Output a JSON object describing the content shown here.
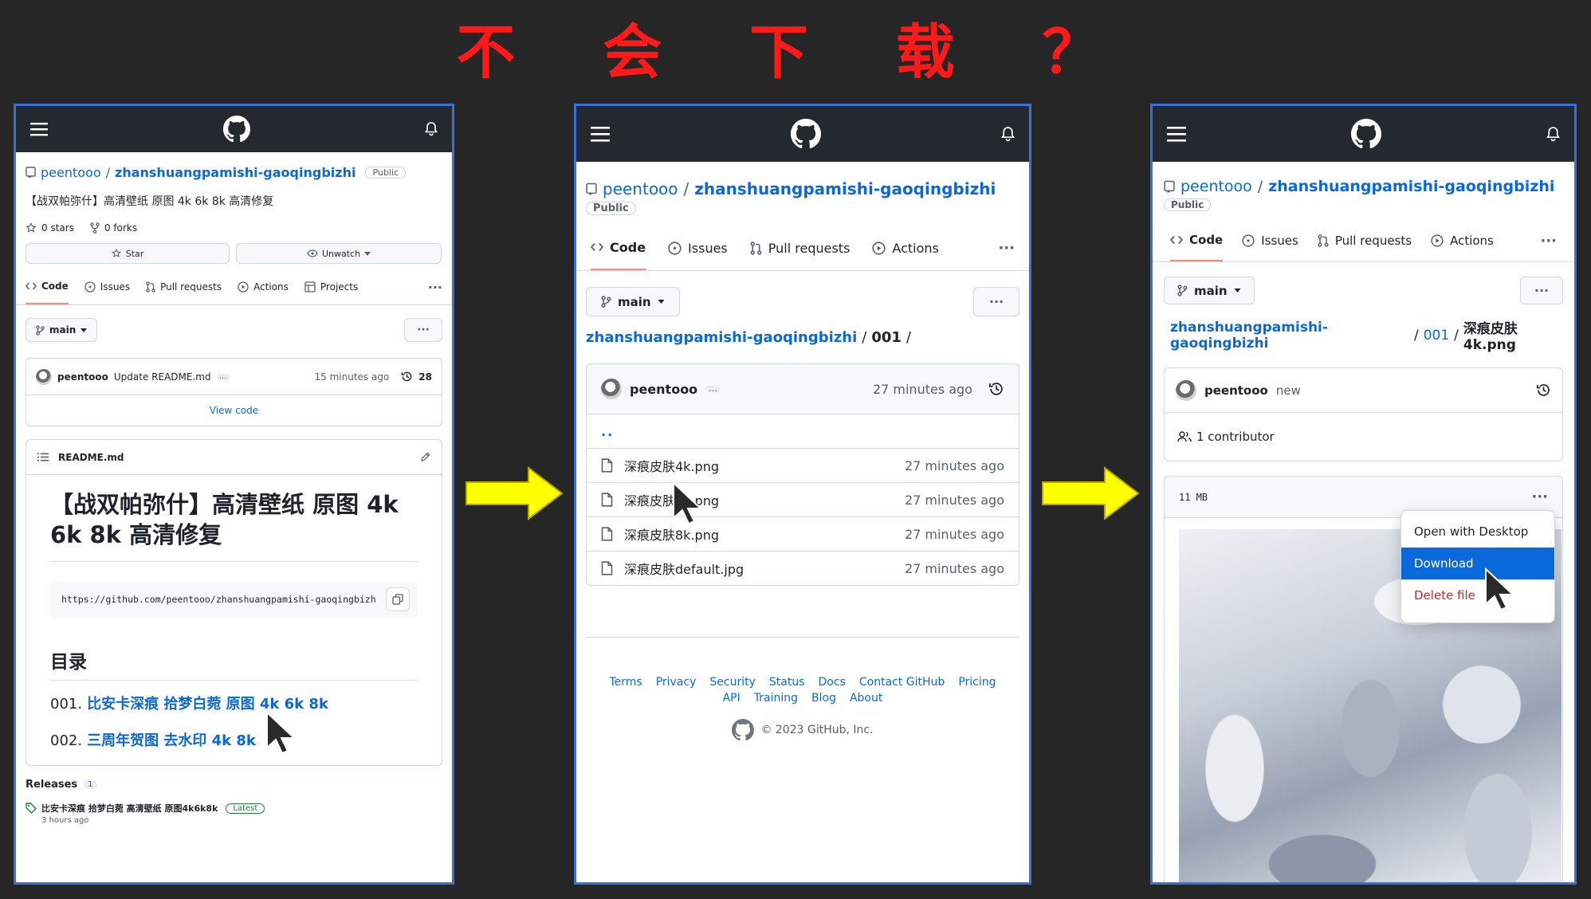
{
  "title": "不 会 下 载 ？",
  "colors": {
    "accent_red": "#ff1a1a",
    "arrow": "#ffff00",
    "frame": "#3a6fd8",
    "link": "#0969da",
    "header": "#24292f"
  },
  "icons": [
    "menu-icon",
    "github-logo-icon",
    "bell-icon",
    "repo-icon",
    "star-icon",
    "fork-icon",
    "eye-icon",
    "code-icon",
    "issue-icon",
    "pull-request-icon",
    "actions-icon",
    "projects-icon",
    "branch-icon",
    "history-icon",
    "list-icon",
    "pencil-icon",
    "copy-icon",
    "file-icon",
    "tag-icon",
    "people-icon",
    "cursor-icon",
    "arrow-icon"
  ],
  "p1": {
    "owner": "peentooo",
    "repo": "zhanshuangpamishi-gaoqingbizhi",
    "visibility": "Public",
    "description": "【战双帕弥什】高清壁纸 原图 4k 6k 8k 高清修复",
    "stars": "0 stars",
    "forks": "0 forks",
    "star_btn": "Star",
    "watch_btn": "Unwatch",
    "tabs": [
      "Code",
      "Issues",
      "Pull requests",
      "Actions",
      "Projects"
    ],
    "more": "···",
    "branch": "main",
    "commit_user": "peentooo",
    "commit_msg": "Update README.md",
    "commit_dots": "…",
    "commit_time": "15 minutes ago",
    "commit_count": "28",
    "view_code": "View code",
    "readme_name": "README.md",
    "readme_title": "【战双帕弥什】高清壁纸 原图 4k 6k 8k 高清修复",
    "url": "https://github.com/peentooo/zhanshuangpamishi-gaoqingbizh",
    "toc_heading": "目录",
    "toc": [
      {
        "num": "001.",
        "text": "比安卡深痕 拾梦白菀 原图 4k 6k 8k"
      },
      {
        "num": "002.",
        "text": "三周年贺图 去水印 4k 8k"
      }
    ],
    "releases_label": "Releases",
    "releases_count": "1",
    "release_name": "比安卡深痕 拾梦白菀 高清壁纸 原图4k6k8k",
    "release_badge": "Latest",
    "release_time": "3 hours ago"
  },
  "p2": {
    "owner": "peentooo",
    "repo": "zhanshuangpamishi-gaoqingbizhi",
    "visibility": "Public",
    "tabs": [
      "Code",
      "Issues",
      "Pull requests",
      "Actions"
    ],
    "more": "···",
    "branch": "main",
    "path_repo": "zhanshuangpamishi-gaoqingbizhi",
    "path_dir": "001",
    "path_sep": "/",
    "commit_user": "peentooo",
    "commit_dots": "…",
    "commit_time": "27 minutes ago",
    "parent": "..",
    "files": [
      {
        "name": "深痕皮肤4k.png",
        "time": "27 minutes ago"
      },
      {
        "name": "深痕皮肤6k.png",
        "time": "27 minutes ago"
      },
      {
        "name": "深痕皮肤8k.png",
        "time": "27 minutes ago"
      },
      {
        "name": "深痕皮肤default.jpg",
        "time": "27 minutes ago"
      }
    ],
    "footer_links": [
      "Terms",
      "Privacy",
      "Security",
      "Status",
      "Docs",
      "Contact GitHub",
      "Pricing",
      "API",
      "Training",
      "Blog",
      "About"
    ],
    "copyright": "© 2023 GitHub, Inc."
  },
  "p3": {
    "owner": "peentooo",
    "repo": "zhanshuangpamishi-gaoqingbizhi",
    "visibility": "Public",
    "tabs": [
      "Code",
      "Issues",
      "Pull requests",
      "Actions"
    ],
    "more": "···",
    "branch": "main",
    "path_repo": "zhanshuangpamishi-gaoqingbizhi",
    "path_dir": "001",
    "path_file": "深痕皮肤4k.png",
    "path_sep": "/",
    "commit_user": "peentooo",
    "commit_msg": "new",
    "contributors": "1 contributor",
    "file_size": "11 MB",
    "menu": [
      "Open with Desktop",
      "Download",
      "Delete file"
    ]
  }
}
